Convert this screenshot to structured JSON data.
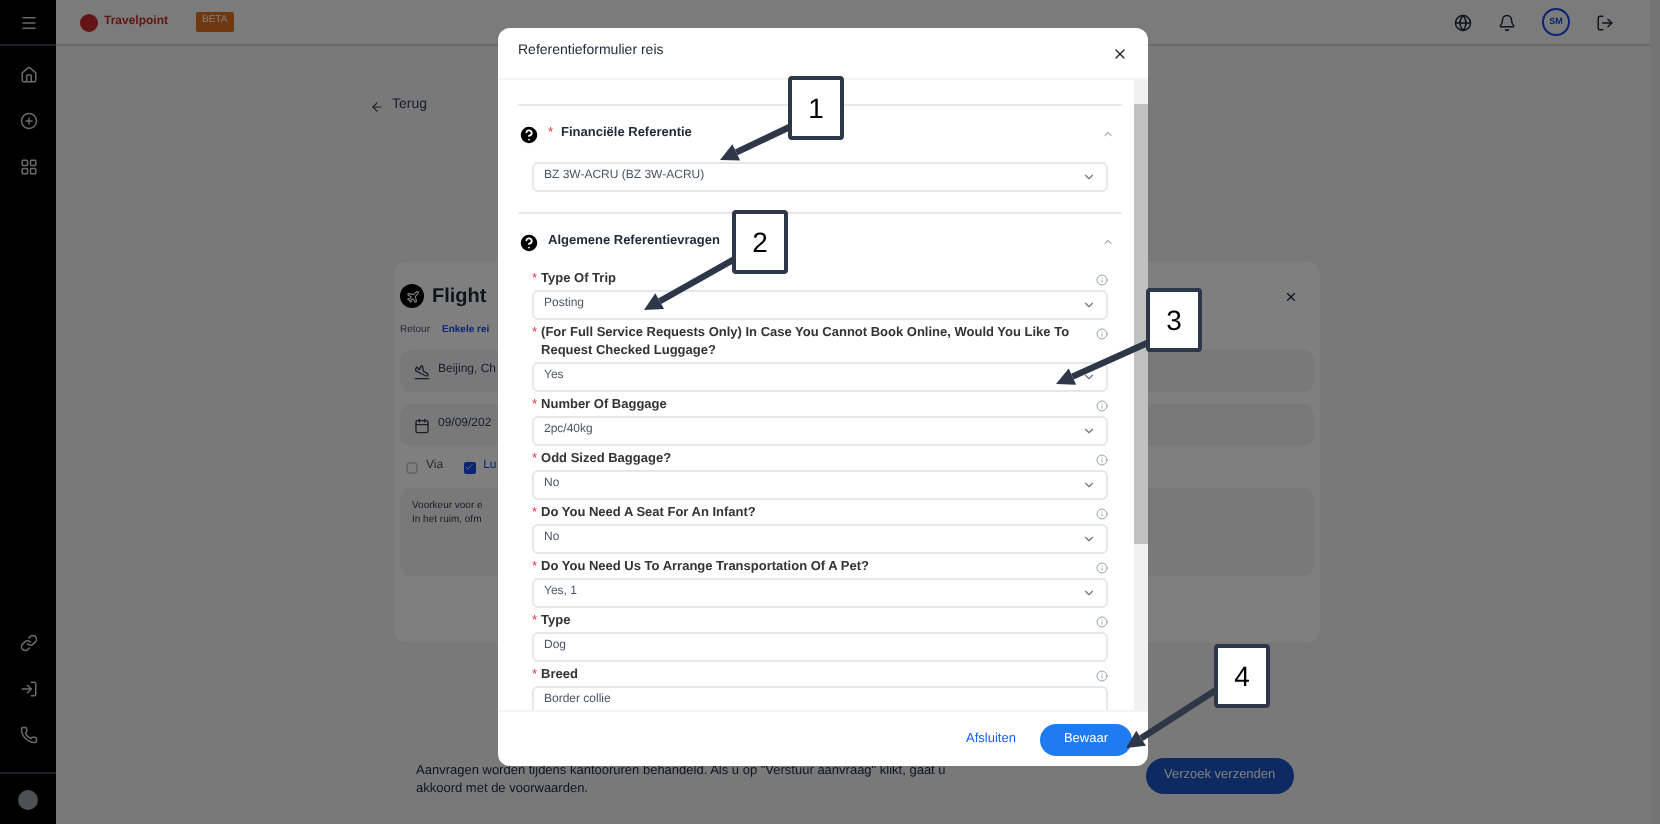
{
  "header": {
    "brand": "Travelpoint",
    "badge": "BETA",
    "avatar": "SM"
  },
  "page": {
    "back": "Terug",
    "flight": {
      "title": "Flight",
      "trip_types": [
        {
          "label": "Retour",
          "selected": false
        },
        {
          "label": "Enkele rei",
          "selected": true
        }
      ],
      "route": "Beijing, Ch",
      "date": "09/09/202",
      "options": [
        {
          "label": "Via",
          "checked": false
        },
        {
          "label": "Lu",
          "checked": true
        }
      ],
      "notes": [
        "Voorkeur voor e",
        "In het ruim, ofm"
      ]
    },
    "footer_note": "Aanvragen worden tijdens kantooruren behandeld. Als u op \"Verstuur aanvraag\" klikt, gaat u akkoord met de voorwaarden.",
    "submit": "Verzoek verzenden"
  },
  "dialog": {
    "title": "Referentieformulier reis",
    "sections": [
      {
        "title": "Financiële Referentie",
        "required_mark": "*",
        "expanded": true,
        "fields": [
          {
            "kind": "select",
            "value": "BZ 3W-ACRU (BZ 3W-ACRU)"
          }
        ]
      },
      {
        "title": "Algemene Referentievragen",
        "expanded": true,
        "fields": [
          {
            "kind": "select",
            "required_mark": "*",
            "label": "Type Of Trip",
            "value": "Posting"
          },
          {
            "kind": "select",
            "required_mark": "*",
            "label": "(For Full Service Requests Only) In Case You Cannot Book Online, Would You Like To Request Checked Luggage?",
            "value": "Yes"
          },
          {
            "kind": "select",
            "required_mark": "*",
            "label": "Number Of Baggage",
            "value": "2pc/40kg"
          },
          {
            "kind": "select",
            "required_mark": "*",
            "label": "Odd Sized Baggage?",
            "value": "No"
          },
          {
            "kind": "select",
            "required_mark": "*",
            "label": "Do You Need A Seat For An Infant?",
            "value": "No"
          },
          {
            "kind": "select",
            "required_mark": "*",
            "label": "Do You Need Us To Arrange Transportation Of A Pet?",
            "value": "Yes, 1"
          },
          {
            "kind": "text",
            "required_mark": "*",
            "label": "Type",
            "value": "Dog"
          },
          {
            "kind": "text",
            "required_mark": "*",
            "label": "Breed",
            "value": "Border collie"
          }
        ]
      }
    ],
    "cancel": "Afsluiten",
    "save": "Bewaar"
  },
  "annotations": [
    {
      "number": "1"
    },
    {
      "number": "2"
    },
    {
      "number": "3"
    },
    {
      "number": "4"
    }
  ]
}
